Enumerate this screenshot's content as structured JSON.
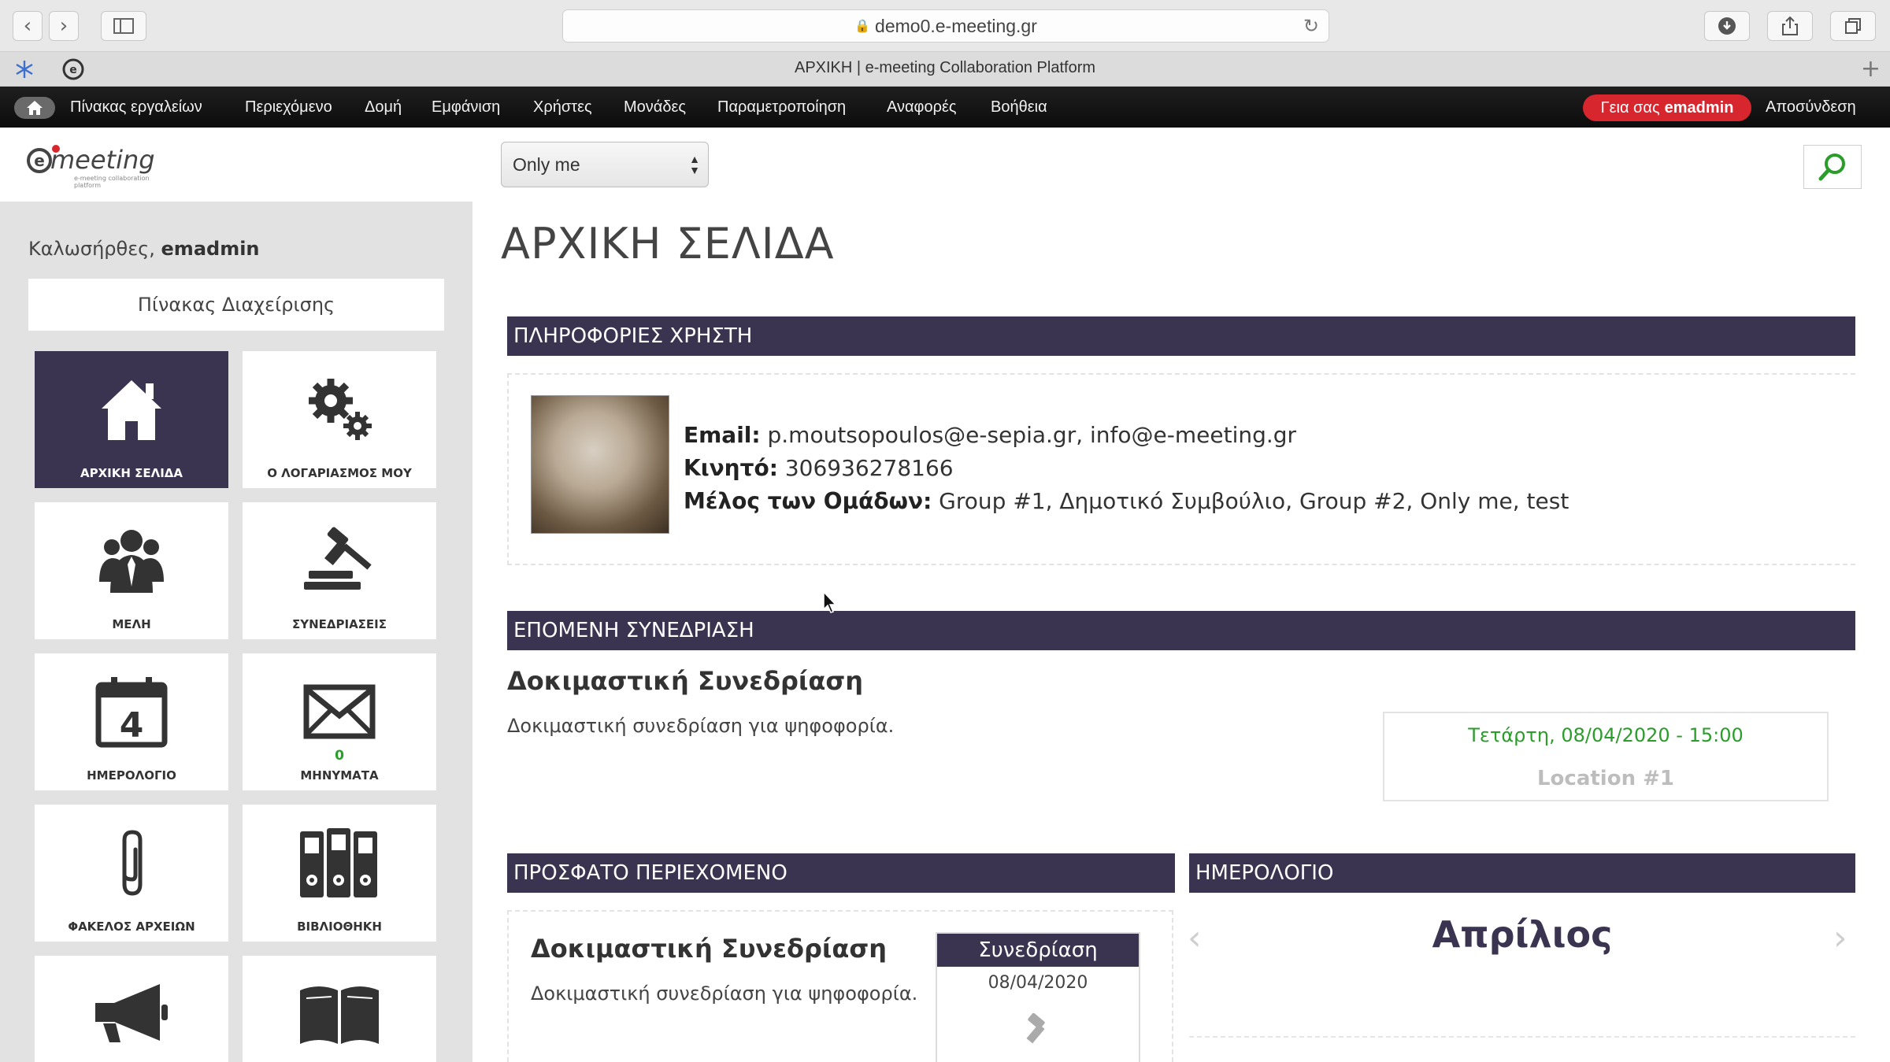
{
  "browser": {
    "url": "demo0.e-meeting.gr",
    "tab_title": "ΑΡΧΙΚΗ | e-meeting Collaboration Platform"
  },
  "admin_toolbar": {
    "items": [
      "Πίνακας εργαλείων",
      "Περιεχόμενο",
      "Δομή",
      "Εμφάνιση",
      "Χρήστες",
      "Μονάδες",
      "Παραμετροποίηση",
      "Αναφορές",
      "Βοήθεια"
    ],
    "greeting_prefix": "Γεια σας",
    "greeting_user": "emadmin",
    "logout": "Αποσύνδεση"
  },
  "logo": {
    "word": "meeting",
    "letter": "e",
    "tagline": "e-meeting collaboration platform"
  },
  "group_select": {
    "value": "Only me"
  },
  "sidebar": {
    "welcome_prefix": "Καλωσήρθες,",
    "welcome_user": "emadmin",
    "admin_panel": "Πίνακας Διαχείρισης",
    "tiles": [
      {
        "label": "ΑΡΧΙΚΗ ΣΕΛΙΔΑ",
        "icon": "home-icon",
        "active": true
      },
      {
        "label": "Ο ΛΟΓΑΡΙΑΣΜΟΣ ΜΟΥ",
        "icon": "gears-icon"
      },
      {
        "label": "ΜΕΛΗ",
        "icon": "members-icon"
      },
      {
        "label": "ΣΥΝΕΔΡΙΑΣΕΙΣ",
        "icon": "gavel-icon"
      },
      {
        "label": "ΗΜΕΡΟΛΟΓΙΟ",
        "icon": "calendar-icon",
        "day": "4"
      },
      {
        "label": "ΜΗΝΥΜΑΤΑ",
        "icon": "envelope-icon",
        "count": "0"
      },
      {
        "label": "ΦΑΚΕΛΟΣ ΑΡΧΕΙΩΝ",
        "icon": "paperclip-icon"
      },
      {
        "label": "ΒΙΒΛΙΟΘΗΚΗ",
        "icon": "binders-icon"
      },
      {
        "label": "",
        "icon": "megaphone-icon"
      },
      {
        "label": "",
        "icon": "book-icon"
      }
    ]
  },
  "main": {
    "page_title": "ΑΡΧΙΚΗ ΣΕΛΙΔΑ",
    "user_info": {
      "heading": "ΠΛΗΡΟΦΟΡΙΕΣ ΧΡΗΣΤΗ",
      "email_label": "Email:",
      "email_value": "p.moutsopoulos@e-sepia.gr, info@e-meeting.gr",
      "mobile_label": "Κινητό:",
      "mobile_value": "306936278166",
      "groups_label": "Μέλος των Ομάδων:",
      "groups_value": "Group #1, Δημοτικό Συμβούλιο, Group #2, Only me, test"
    },
    "next_meeting": {
      "heading": "ΕΠΟΜΕΝΗ ΣΥΝΕΔΡΙΑΣΗ",
      "title": "Δοκιμαστική Συνεδρίαση",
      "description": "Δοκιμαστική συνεδρίαση για ψηφοφορία.",
      "datetime": "Τετάρτη, 08/04/2020 - 15:00",
      "location": "Location #1"
    },
    "recent_content": {
      "heading": "ΠΡΟΣΦΑΤΟ ΠΕΡΙΕΧΟΜΕΝΟ",
      "title": "Δοκιμαστική Συνεδρίαση",
      "description": "Δοκιμαστική συνεδρίαση για ψηφοφορία.",
      "card_type": "Συνεδρίαση",
      "card_date": "08/04/2020"
    },
    "calendar": {
      "heading": "ΗΜΕΡΟΛΟΓΙΟ",
      "month": "Απρίλιος"
    }
  },
  "colors": {
    "accent_dark": "#3b3450",
    "alert_red": "#d8262e",
    "success_green": "#2a9d2a"
  }
}
